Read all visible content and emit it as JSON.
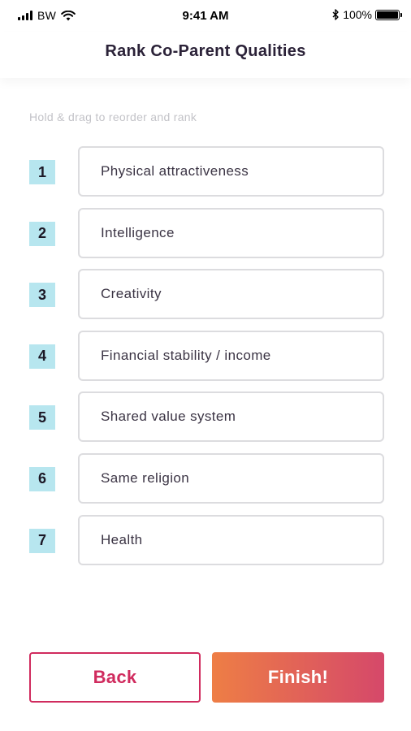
{
  "status_bar": {
    "carrier": "BW",
    "time": "9:41 AM",
    "battery_percent": "100%",
    "battery_level": 1.0
  },
  "nav": {
    "title": "Rank Co-Parent Qualities"
  },
  "hint": "Hold & drag to reorder and rank",
  "ranks": [
    {
      "number": "1",
      "label": "Physical attractiveness"
    },
    {
      "number": "2",
      "label": "Intelligence"
    },
    {
      "number": "3",
      "label": "Creativity"
    },
    {
      "number": "4",
      "label": "Financial stability / income"
    },
    {
      "number": "5",
      "label": "Shared value system"
    },
    {
      "number": "6",
      "label": "Same religion"
    },
    {
      "number": "7",
      "label": "Health"
    }
  ],
  "buttons": {
    "back": "Back",
    "finish": "Finish!"
  },
  "colors": {
    "accent": "#d02b5e",
    "badge": "#b7e6ef",
    "gradient_start": "#ee7e45",
    "gradient_end": "#d5486a"
  },
  "icons": {
    "signal": "signal-icon",
    "wifi": "wifi-icon",
    "bluetooth": "bluetooth-icon",
    "battery": "battery-icon"
  }
}
